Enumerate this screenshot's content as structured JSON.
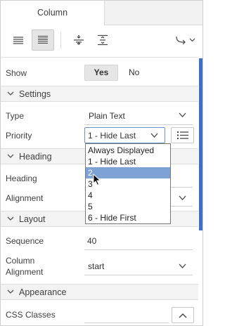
{
  "tabs": {
    "active": "Column"
  },
  "toolbar": {
    "icons": [
      "align-left-icon",
      "align-justify-icon",
      "split-horizontal-icon",
      "fit-vertical-icon",
      "redo-icon",
      "chevron-down-icon"
    ]
  },
  "show": {
    "label": "Show",
    "yes": "Yes",
    "no": "No"
  },
  "settings": {
    "title": "Settings",
    "type_label": "Type",
    "type_value": "Plain Text",
    "priority_label": "Priority",
    "priority_value": "1 - Hide Last",
    "priority_options": [
      "Always Displayed",
      "1 - Hide Last",
      "2",
      "3",
      "4",
      "5",
      "6 - Hide First"
    ],
    "priority_highlighted": "2"
  },
  "heading": {
    "title": "Heading",
    "heading_label": "Heading",
    "alignment_label": "Alignment"
  },
  "layout": {
    "title": "Layout",
    "sequence_label": "Sequence",
    "sequence_value": "40",
    "column_alignment_label_1": "Column",
    "column_alignment_label_2": "Alignment",
    "column_alignment_value": "start"
  },
  "appearance": {
    "title": "Appearance",
    "css_classes_label": "CSS Classes"
  },
  "colors": {
    "accent": "#3b6fc8",
    "highlight": "#7fa2d4",
    "section_bg": "#f3f3f3"
  }
}
